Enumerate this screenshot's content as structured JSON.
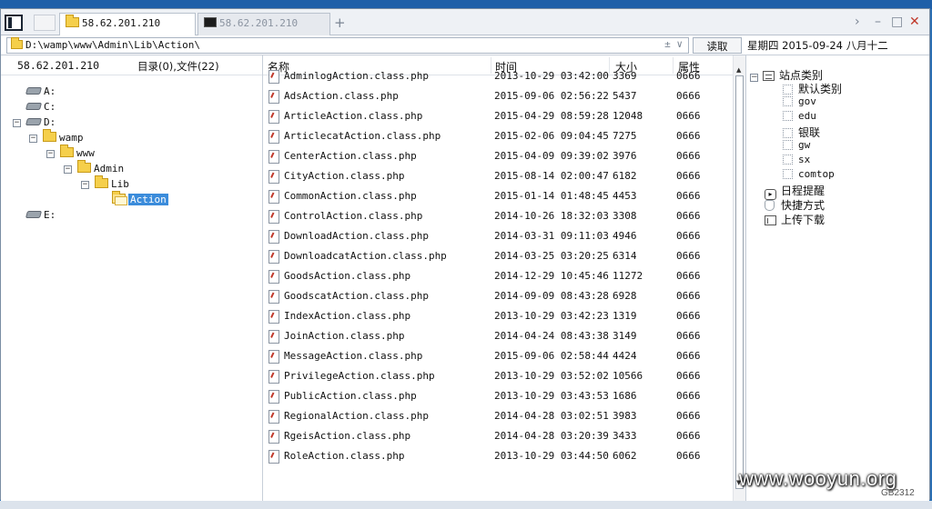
{
  "window": {
    "tabs": [
      {
        "label": "58.62.201.210",
        "active": true,
        "icon": "folder-icon"
      },
      {
        "label": "58.62.201.210",
        "active": false,
        "icon": "terminal-icon"
      }
    ],
    "new_tab": "+",
    "controls": {
      "forward": "›",
      "minimize": "–",
      "maximize": "□",
      "close": "✕"
    }
  },
  "address": {
    "path": "D:\\wamp\\www\\Admin\\Lib\\Action\\",
    "dropdown_icons": "± ∨",
    "read_button": "读取"
  },
  "date_text": "星期四 2015-09-24 八月十二",
  "left": {
    "host": "58.62.201.210",
    "summary": "目录(0),文件(22)",
    "tree": [
      {
        "label": "A:",
        "kind": "drive",
        "level": 0,
        "expander": ""
      },
      {
        "label": "C:",
        "kind": "drive",
        "level": 0,
        "expander": ""
      },
      {
        "label": "D:",
        "kind": "drive",
        "level": 0,
        "expander": "−"
      },
      {
        "label": "wamp",
        "kind": "folder",
        "level": 1,
        "expander": "−"
      },
      {
        "label": "www",
        "kind": "folder",
        "level": 2,
        "expander": "−"
      },
      {
        "label": "Admin",
        "kind": "folder",
        "level": 3,
        "expander": "−"
      },
      {
        "label": "Lib",
        "kind": "folder",
        "level": 4,
        "expander": "−"
      },
      {
        "label": "Action",
        "kind": "folder-open",
        "level": 5,
        "expander": "",
        "selected": true
      },
      {
        "label": "E:",
        "kind": "drive",
        "level": 0,
        "expander": ""
      }
    ]
  },
  "files": {
    "columns": {
      "name": "名称",
      "time": "时间",
      "size": "大小",
      "attr": "属性"
    },
    "rows": [
      {
        "name": "AdminlogAction.class.php",
        "time": "2013-10-29 03:42:00",
        "size": "3369",
        "attr": "0666"
      },
      {
        "name": "AdsAction.class.php",
        "time": "2015-09-06 02:56:22",
        "size": "5437",
        "attr": "0666"
      },
      {
        "name": "ArticleAction.class.php",
        "time": "2015-04-29 08:59:28",
        "size": "12048",
        "attr": "0666"
      },
      {
        "name": "ArticlecatAction.class.php",
        "time": "2015-02-06 09:04:45",
        "size": "7275",
        "attr": "0666"
      },
      {
        "name": "CenterAction.class.php",
        "time": "2015-04-09 09:39:02",
        "size": "3976",
        "attr": "0666"
      },
      {
        "name": "CityAction.class.php",
        "time": "2015-08-14 02:00:47",
        "size": "6182",
        "attr": "0666"
      },
      {
        "name": "CommonAction.class.php",
        "time": "2015-01-14 01:48:45",
        "size": "4453",
        "attr": "0666"
      },
      {
        "name": "ControlAction.class.php",
        "time": "2014-10-26 18:32:03",
        "size": "3308",
        "attr": "0666"
      },
      {
        "name": "DownloadAction.class.php",
        "time": "2014-03-31 09:11:03",
        "size": "4946",
        "attr": "0666"
      },
      {
        "name": "DownloadcatAction.class.php",
        "time": "2014-03-25 03:20:25",
        "size": "6314",
        "attr": "0666"
      },
      {
        "name": "GoodsAction.class.php",
        "time": "2014-12-29 10:45:46",
        "size": "11272",
        "attr": "0666"
      },
      {
        "name": "GoodscatAction.class.php",
        "time": "2014-09-09 08:43:28",
        "size": "6928",
        "attr": "0666"
      },
      {
        "name": "IndexAction.class.php",
        "time": "2013-10-29 03:42:23",
        "size": "1319",
        "attr": "0666"
      },
      {
        "name": "JoinAction.class.php",
        "time": "2014-04-24 08:43:38",
        "size": "3149",
        "attr": "0666"
      },
      {
        "name": "MessageAction.class.php",
        "time": "2015-09-06 02:58:44",
        "size": "4424",
        "attr": "0666"
      },
      {
        "name": "PrivilegeAction.class.php",
        "time": "2013-10-29 03:52:02",
        "size": "10566",
        "attr": "0666"
      },
      {
        "name": "PublicAction.class.php",
        "time": "2013-10-29 03:43:53",
        "size": "1686",
        "attr": "0666"
      },
      {
        "name": "RegionalAction.class.php",
        "time": "2014-04-28 03:02:51",
        "size": "3983",
        "attr": "0666"
      },
      {
        "name": "RgeisAction.class.php",
        "time": "2014-04-28 03:20:39",
        "size": "3433",
        "attr": "0666"
      },
      {
        "name": "RoleAction.class.php",
        "time": "2013-10-29 03:44:50",
        "size": "6062",
        "attr": "0666"
      }
    ]
  },
  "right": {
    "root": "站点类别",
    "categories": [
      "默认类别",
      "gov",
      "edu",
      "银联",
      "gw",
      "sx",
      "comtop"
    ],
    "items": [
      {
        "label": "日程提醒",
        "icon": "calendar-icon"
      },
      {
        "label": "快捷方式",
        "icon": "shortcut-icon"
      },
      {
        "label": "上传下载",
        "icon": "upload-icon"
      }
    ]
  },
  "watermark": "www.wooyun.org",
  "encoding": "GB2312",
  "colors": {
    "selection": "#3b8cdb",
    "folder": "#f5cf4b",
    "close": "#c0392b"
  }
}
